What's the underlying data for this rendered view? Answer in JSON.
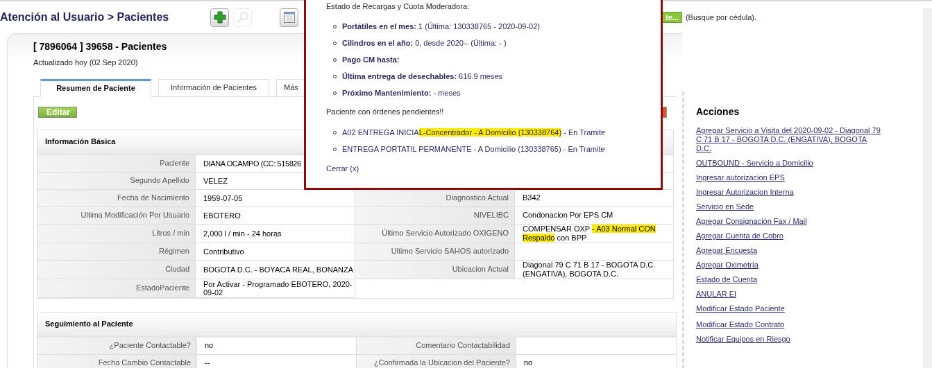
{
  "header": {
    "title": "Atención al Usuario > Pacientes",
    "toolbar": [
      {
        "kind": "add",
        "disabled": false
      },
      {
        "kind": "search",
        "disabled": true
      },
      {
        "kind": "calendar",
        "disabled": false
      }
    ],
    "search_button": "te...",
    "search_hint": "(Busque por cédula)."
  },
  "record": {
    "title": "[ 7896064 ] 39658 - Pacientes",
    "updated": "Actualizado hoy (02 Sep 2020)",
    "tabs": [
      {
        "label": "Resumen de Paciente",
        "selected": true
      },
      {
        "label": "Información de Pacientes",
        "selected": false
      },
      {
        "label": "Más",
        "selected": false
      }
    ],
    "edit_button": "Editar",
    "basic_info": {
      "title": "Información Básica",
      "left": [
        {
          "label": "Paciente",
          "value": "DIANA OCAMPO (CC: 515826"
        },
        {
          "label": "Segundo Apellido",
          "value": "VELEZ"
        },
        {
          "label": "Fecha de Nacimiento",
          "value": "1959-07-05"
        },
        {
          "label": "Ultima Modificación Por Usuario",
          "value": "EBOTERO"
        },
        {
          "label": "Litros / min",
          "value": "2,000 l / min - 24 horas"
        },
        {
          "label": "Régimen",
          "value": "Contributivo"
        },
        {
          "label": "Ciudad",
          "value": "BOGOTA D.C. - BOYACA REAL, BONANZA"
        },
        {
          "label": "EstadoPaciente",
          "value": "Por Activar - Programado EBOTERO, 2020-09-02"
        }
      ],
      "right": [
        {
          "label": "Diagnostico Actual",
          "value": [
            {
              "text": "B342",
              "highlighted": false
            }
          ]
        },
        {
          "label": "NIVELIBC",
          "value": [
            {
              "text": "Condonacion Por EPS CM",
              "highlighted": false
            }
          ]
        },
        {
          "label": "Último Servicio Autorizado OXIGENO",
          "value": [
            {
              "text": "COMPENSAR OXP ",
              "highlighted": false
            },
            {
              "text": "- A03 Normal CON Respaldo",
              "highlighted": true
            },
            {
              "text": " con BPP",
              "highlighted": false
            }
          ]
        },
        {
          "label": "Ultimo Servicio SAHOS autorizado"
        },
        {
          "label": "Ubicacion Actual",
          "value": [
            {
              "text": "Diagonal 79 C 71 B 17 - BOGOTA D.C. (ENGATIVA), BOGOTA D.C.",
              "highlighted": false
            }
          ]
        }
      ]
    },
    "follow_up": {
      "title": "Seguimiento al Paciente",
      "rows": [
        [
          {
            "label": "¿Paciente Contactable?",
            "value": "no"
          },
          {
            "label": "Comentario Contactabilidad"
          }
        ],
        [
          {
            "label": "Fecha Cambio Contactable",
            "value": "--"
          },
          {
            "label": "¿Confirmada la Ubicacion del Paciente?",
            "value": "no"
          }
        ]
      ]
    }
  },
  "actions": {
    "title": "Acciones",
    "groups": [
      [
        "Agregar Servicio a Visita del 2020-09-02 - Diagonal 79 C 71 B 17 - BOGOTA D.C. (ENGATIVA), BOGOTA D.C.",
        "OUTBOUND - Servicio a Domicilio",
        "Ingresar autorizacion EPS",
        "Ingresar Autorizacion Interna",
        "Servicio en Sede",
        "Agregar Consignación Fax / Mail",
        "Agregar Cuenta de Cobro",
        "Agregar Encuesta",
        "Agregar Oximetría",
        "Estado de Cuenta",
        "ANULAR EI",
        "Modificar Estado Paciente"
      ],
      [
        "Modificar Estado Contrato",
        "Notificar Equipos en Riesgo"
      ]
    ]
  },
  "popup": {
    "heading": "Estado de Recargas y Cuota Moderadora:",
    "status": [
      "**Portátiles en el mes:** 1 (Última: 130338765 - 2020-09-02)",
      "**Cilindros en el año:** 0, desde 2020-- (Última: - )",
      "**Pago CM hasta:**",
      "**Última entrega de desechables:** 616.9 meses",
      "**Próximo Mantenimiento:** - meses"
    ],
    "pending_title": "Paciente con órdenes pendientes!!",
    "pending": [
      [
        {
          "text": "A02 ENTREGA INICIA",
          "highlighted": false
        },
        {
          "text": "L-Concentrador - A Domicilio (130338764)",
          "highlighted": true
        },
        {
          "text": " - En Tramite",
          "highlighted": false
        }
      ],
      [
        {
          "text": "ENTREGA PORTATIL PERMANENTE - A Domicilio (130338765) - En Tramite",
          "highlighted": false
        }
      ]
    ],
    "close": "Cerrar (x)"
  }
}
